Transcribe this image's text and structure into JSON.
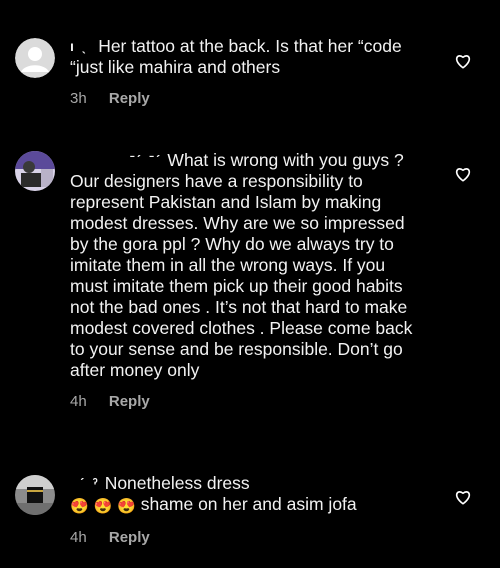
{
  "colors": {
    "background": "#000000",
    "text": "#f2f2f2",
    "muted": "#a8a8a8"
  },
  "comments": [
    {
      "username_fragment": "ı    ˎ",
      "text": "Her tattoo at the back. Is that her “code “just like mahira and others",
      "time": "3h",
      "reply_label": "Reply",
      "avatar": "default-avatar-icon"
    },
    {
      "username_fragment": "ˉˊ ˉˊ",
      "text": "What is wrong with you guys ? Our designers have a responsibility to represent Pakistan and Islam by making modest dresses. Why are we so impressed by the gora ppl ? Why do we always try to imitate them in all the wrong ways. If you must imitate them pick up their good habits not the bad ones .  It’s not that hard to make modest covered clothes .  Please come back to your sense and be responsible. Don’t go after money only",
      "time": "4h",
      "reply_label": "Reply",
      "avatar": "photo-avatar"
    },
    {
      "username_fragment": "ˊ                              ˀ",
      "text": "Nonetheless dress",
      "text_line2": "shame on her and asim jofa",
      "emojis": [
        "😍",
        "😍",
        "😍"
      ],
      "time": "4h",
      "reply_label": "Reply",
      "avatar": "kaaba-avatar"
    }
  ]
}
